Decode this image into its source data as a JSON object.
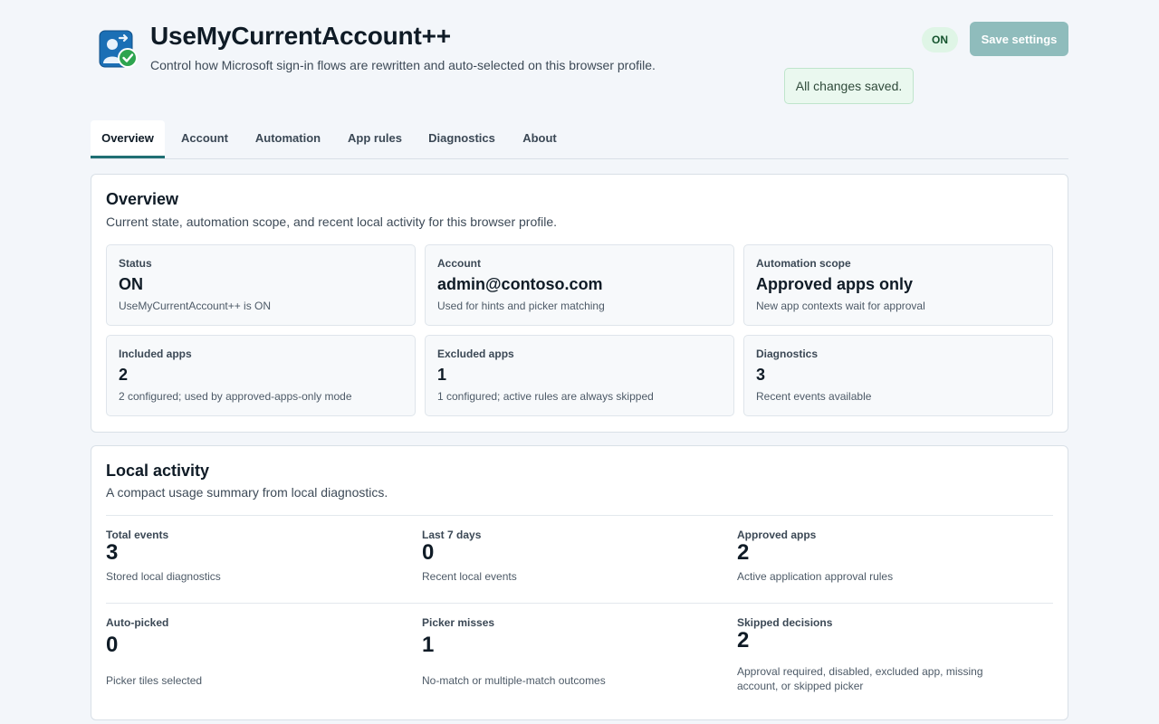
{
  "header": {
    "title": "UseMyCurrentAccount++",
    "subtitle": "Control how Microsoft sign-in flows are rewritten and auto-selected on this browser profile.",
    "status_pill": "ON",
    "save_label": "Save settings",
    "toast": "All changes saved."
  },
  "tabs": [
    {
      "label": "Overview"
    },
    {
      "label": "Account"
    },
    {
      "label": "Automation"
    },
    {
      "label": "App rules"
    },
    {
      "label": "Diagnostics"
    },
    {
      "label": "About"
    }
  ],
  "overview": {
    "title": "Overview",
    "subtitle": "Current state, automation scope, and recent local activity for this browser profile.",
    "cards": [
      {
        "label": "Status",
        "value": "ON",
        "desc": "UseMyCurrentAccount++ is ON"
      },
      {
        "label": "Account",
        "value": "admin@contoso.com",
        "desc": "Used for hints and picker matching"
      },
      {
        "label": "Automation scope",
        "value": "Approved apps only",
        "desc": "New app contexts wait for approval"
      },
      {
        "label": "Included apps",
        "value": "2",
        "desc": "2 configured; used by approved-apps-only mode"
      },
      {
        "label": "Excluded apps",
        "value": "1",
        "desc": "1 configured; active rules are always skipped"
      },
      {
        "label": "Diagnostics",
        "value": "3",
        "desc": "Recent events available"
      }
    ]
  },
  "activity": {
    "title": "Local activity",
    "subtitle": "A compact usage summary from local diagnostics.",
    "stats": [
      {
        "label": "Total events",
        "value": "3",
        "desc": "Stored local diagnostics"
      },
      {
        "label": "Last 7 days",
        "value": "0",
        "desc": "Recent local events"
      },
      {
        "label": "Approved apps",
        "value": "2",
        "desc": "Active application approval rules"
      },
      {
        "label": "Auto-picked",
        "value": "0",
        "desc": "Picker tiles selected"
      },
      {
        "label": "Picker misses",
        "value": "1",
        "desc": "No-match or multiple-match outcomes"
      },
      {
        "label": "Skipped decisions",
        "value": "2",
        "desc": "Approval required, disabled, excluded app, missing account, or skipped picker"
      }
    ]
  },
  "icons": {
    "logo": "account-check-logo-icon"
  },
  "colors": {
    "accent": "#1f6f73",
    "on_pill_bg": "#dff5e6",
    "save_button_bg": "#8fbcbc",
    "toast_bg": "#eaf8ef",
    "logo_blue": "#1b6fb5",
    "check_green": "#2ea44f"
  }
}
